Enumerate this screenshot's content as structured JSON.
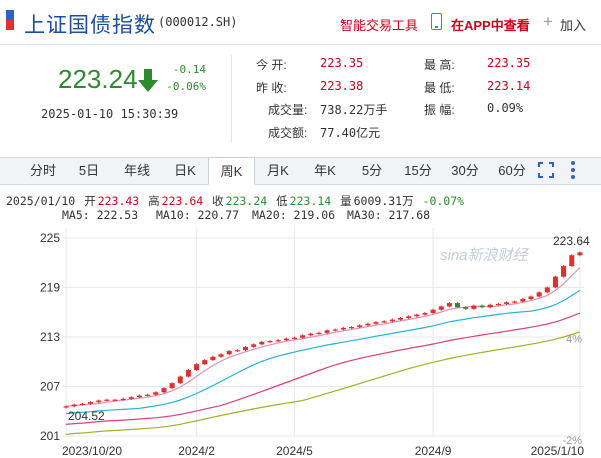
{
  "header": {
    "title": "上证国债指数",
    "code": "(000012.SH)",
    "smart_trade": "智能交易工具",
    "in_app": "在APP中查看",
    "add": "加入"
  },
  "quote": {
    "price": "223.24",
    "change": "-0.14",
    "change_pct": "-0.06%",
    "datetime": "2025-01-10 15:30:39",
    "open_label": "今    开:",
    "open": "223.35",
    "prev_close_label": "昨    收:",
    "prev_close": "223.38",
    "volume_label": "成交量:",
    "volume": "738.22万手",
    "turnover_label": "成交额:",
    "turnover": "77.40亿元",
    "high_label": "最    高:",
    "high": "223.35",
    "low_label": "最    低:",
    "low": "223.14",
    "amplitude_label": "振    幅:",
    "amplitude": "0.09%"
  },
  "tabs": [
    {
      "label": "分时",
      "active": false
    },
    {
      "label": "5日",
      "active": false
    },
    {
      "label": "年线",
      "active": false
    },
    {
      "label": "日K",
      "active": false
    },
    {
      "label": "周K",
      "active": true
    },
    {
      "label": "月K",
      "active": false
    },
    {
      "label": "年K",
      "active": false
    },
    {
      "label": "5分",
      "active": false
    },
    {
      "label": "15分",
      "active": false
    },
    {
      "label": "30分",
      "active": false
    },
    {
      "label": "60分",
      "active": false
    }
  ],
  "bar_info": {
    "date": "2025/01/10",
    "open_label": "开",
    "open": "223.43",
    "high_label": "高",
    "high": "223.64",
    "close_label": "收",
    "close": "223.24",
    "low_label": "低",
    "low": "223.14",
    "vol_label": "量",
    "vol": "6009.31万",
    "pct": "-0.07%"
  },
  "ma": [
    {
      "label": "MA5: 222.53",
      "color": "#e58fb7"
    },
    {
      "label": "MA10: 220.77",
      "color": "#26b3d6"
    },
    {
      "label": "MA20: 219.06",
      "color": "#e0407a"
    },
    {
      "label": "MA30: 217.68",
      "color": "#9ab526"
    }
  ],
  "chart_data": {
    "type": "candlestick",
    "y_ticks": [
      "225",
      "219",
      "213",
      "207",
      "201"
    ],
    "y_tick_values": [
      225,
      219,
      213,
      207,
      201
    ],
    "pct_ticks": [
      "4%",
      "-2%"
    ],
    "pct_tick_values": [
      4,
      -2
    ],
    "x_ticks": [
      "2023/10/20",
      "2024/2",
      "2024/5",
      "2024/9",
      "2025/1/10"
    ],
    "x_tick_index": [
      0,
      16,
      28,
      45,
      63
    ],
    "ylim": [
      201,
      226.2
    ],
    "max_label": "223.64",
    "min_label": "204.52",
    "watermark": "sina新浪财经",
    "closes": [
      204.6,
      204.8,
      204.9,
      205.1,
      205.3,
      205.4,
      205.4,
      205.5,
      205.7,
      205.9,
      206.0,
      206.3,
      206.8,
      207.4,
      208.2,
      209.0,
      209.7,
      210.2,
      210.6,
      210.9,
      211.3,
      211.4,
      211.8,
      212.1,
      212.4,
      212.5,
      212.6,
      212.8,
      212.9,
      213.2,
      213.4,
      213.5,
      213.8,
      213.9,
      214.1,
      214.2,
      214.4,
      214.6,
      214.8,
      214.9,
      215.1,
      215.3,
      215.5,
      215.7,
      215.9,
      216.3,
      216.7,
      217.1,
      216.6,
      216.4,
      216.8,
      216.6,
      216.9,
      217.0,
      217.2,
      217.3,
      217.6,
      217.9,
      218.4,
      219.0,
      220.3,
      221.6,
      222.9,
      223.24
    ],
    "colors": {
      "up": "#e0302e",
      "down": "#2d8b2d"
    },
    "series": [
      {
        "name": "MA5",
        "color": "#e58fb7"
      },
      {
        "name": "MA10",
        "color": "#26b3d6"
      },
      {
        "name": "MA20",
        "color": "#e0407a"
      },
      {
        "name": "MA30",
        "color": "#9ab526"
      }
    ]
  }
}
